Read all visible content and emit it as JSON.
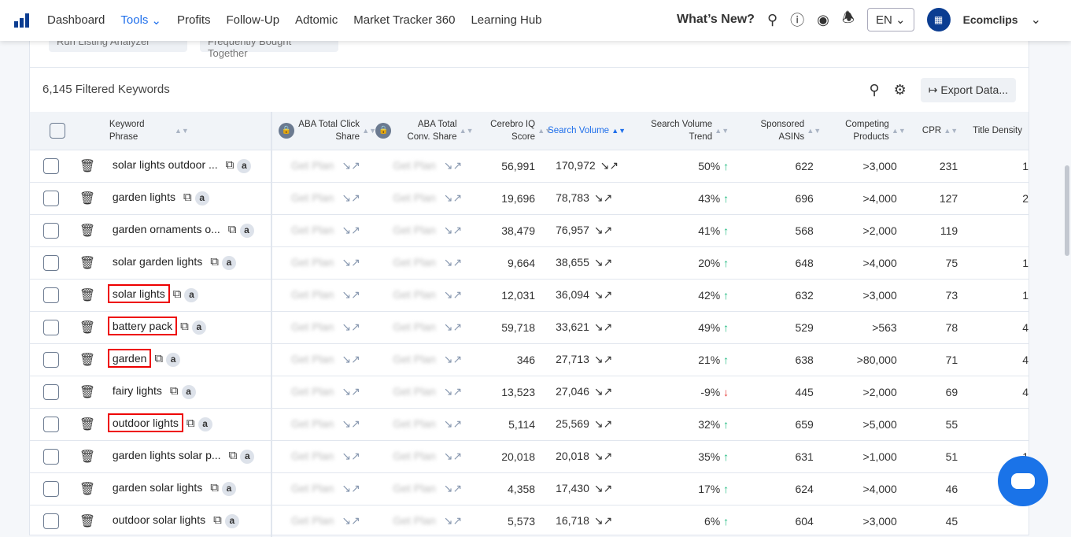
{
  "nav": {
    "items": [
      "Dashboard",
      "Tools",
      "Profits",
      "Follow-Up",
      "Adtomic",
      "Market Tracker 360",
      "Learning Hub"
    ],
    "whats_new": "What’s New?",
    "lang": "EN",
    "account": "Ecomclips"
  },
  "top_buttons": [
    "Run Listing Analyzer",
    "Frequently Bought Together"
  ],
  "toolbar": {
    "count": "6,145 Filtered Keywords",
    "export": "Export Data..."
  },
  "headers": [
    "Keyword Phrase",
    "ABA Total Click Share",
    "ABA Total Conv. Share",
    "Cerebro IQ Score",
    "Search Volume",
    "Search Volume Trend",
    "Sponsored ASINs",
    "Competing Products",
    "CPR",
    "Title Density"
  ],
  "blurred": "Get Plan",
  "rows": [
    {
      "kw": "solar lights outdoor ...",
      "iq": "56,991",
      "sv": "170,972",
      "trend": "50%",
      "dir": "up",
      "sp": "622",
      "cp": ">3,000",
      "cpr": "231",
      "td": "1",
      "box": false
    },
    {
      "kw": "garden lights",
      "iq": "19,696",
      "sv": "78,783",
      "trend": "43%",
      "dir": "up",
      "sp": "696",
      "cp": ">4,000",
      "cpr": "127",
      "td": "2",
      "box": false
    },
    {
      "kw": "garden ornaments o...",
      "iq": "38,479",
      "sv": "76,957",
      "trend": "41%",
      "dir": "up",
      "sp": "568",
      "cp": ">2,000",
      "cpr": "119",
      "td": "",
      "box": false
    },
    {
      "kw": "solar garden lights",
      "iq": "9,664",
      "sv": "38,655",
      "trend": "20%",
      "dir": "up",
      "sp": "648",
      "cp": ">4,000",
      "cpr": "75",
      "td": "1",
      "box": false
    },
    {
      "kw": "solar lights",
      "iq": "12,031",
      "sv": "36,094",
      "trend": "42%",
      "dir": "up",
      "sp": "632",
      "cp": ">3,000",
      "cpr": "73",
      "td": "1",
      "box": true
    },
    {
      "kw": "battery pack",
      "iq": "59,718",
      "sv": "33,621",
      "trend": "49%",
      "dir": "up",
      "sp": "529",
      "cp": ">563",
      "cpr": "78",
      "td": "4",
      "box": true
    },
    {
      "kw": "garden",
      "iq": "346",
      "sv": "27,713",
      "trend": "21%",
      "dir": "up",
      "sp": "638",
      "cp": ">80,000",
      "cpr": "71",
      "td": "4",
      "box": true
    },
    {
      "kw": "fairy lights",
      "iq": "13,523",
      "sv": "27,046",
      "trend": "-9%",
      "dir": "down",
      "sp": "445",
      "cp": ">2,000",
      "cpr": "69",
      "td": "4",
      "box": false
    },
    {
      "kw": "outdoor lights",
      "iq": "5,114",
      "sv": "25,569",
      "trend": "32%",
      "dir": "up",
      "sp": "659",
      "cp": ">5,000",
      "cpr": "55",
      "td": "",
      "box": true
    },
    {
      "kw": "garden lights solar p...",
      "iq": "20,018",
      "sv": "20,018",
      "trend": "35%",
      "dir": "up",
      "sp": "631",
      "cp": ">1,000",
      "cpr": "51",
      "td": "1",
      "box": false
    },
    {
      "kw": "garden solar lights",
      "iq": "4,358",
      "sv": "17,430",
      "trend": "17%",
      "dir": "up",
      "sp": "624",
      "cp": ">4,000",
      "cpr": "46",
      "td": "",
      "box": false
    },
    {
      "kw": "outdoor solar lights",
      "iq": "5,573",
      "sv": "16,718",
      "trend": "6%",
      "dir": "up",
      "sp": "604",
      "cp": ">3,000",
      "cpr": "45",
      "td": "",
      "box": false
    }
  ]
}
